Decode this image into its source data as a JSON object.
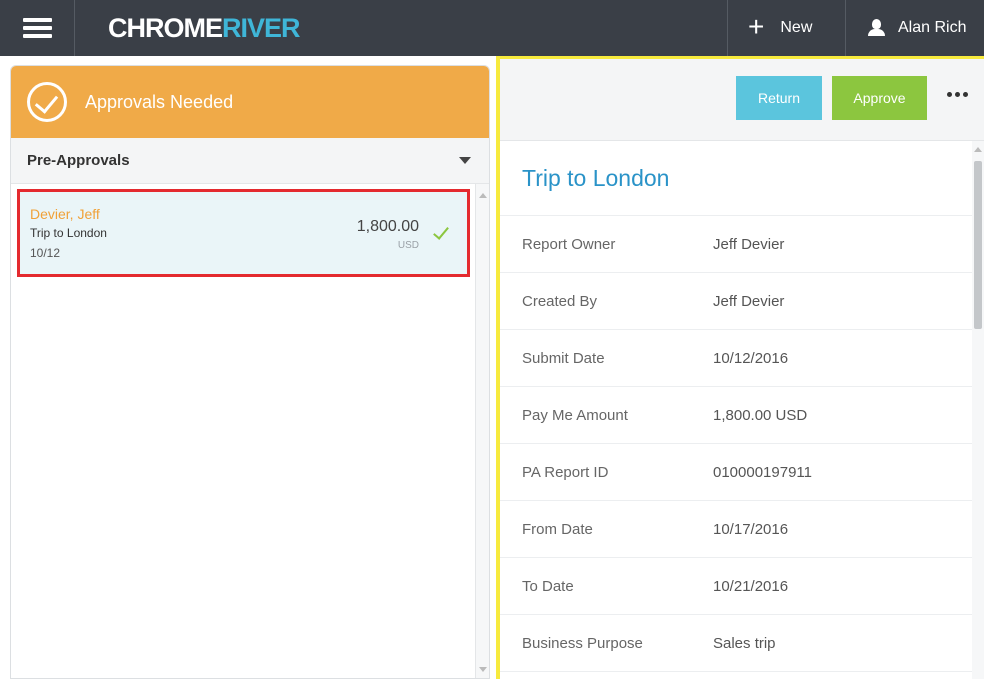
{
  "header": {
    "logo_part1": "CHROME",
    "logo_part2": "RIVER",
    "new_label": "New",
    "new_icon": "plus-icon",
    "user_name": "Alan Rich",
    "user_icon": "user-icon"
  },
  "left_panel": {
    "title": "Approvals Needed",
    "title_icon": "check-circle-icon",
    "section_label": "Pre-Approvals",
    "items": [
      {
        "name": "Devier, Jeff",
        "description": "Trip to London",
        "date": "10/12",
        "amount": "1,800.00",
        "currency": "USD",
        "status_icon": "check-icon"
      }
    ]
  },
  "right_panel": {
    "return_label": "Return",
    "approve_label": "Approve",
    "more_icon": "more-horizontal-icon",
    "title": "Trip to London",
    "fields": [
      {
        "label": "Report Owner",
        "value": "Jeff Devier"
      },
      {
        "label": "Created By",
        "value": "Jeff Devier"
      },
      {
        "label": "Submit Date",
        "value": "10/12/2016"
      },
      {
        "label": "Pay Me Amount",
        "value": "1,800.00 USD"
      },
      {
        "label": "PA Report ID",
        "value": "010000197911"
      },
      {
        "label": "From Date",
        "value": "10/17/2016"
      },
      {
        "label": "To Date",
        "value": "10/21/2016"
      },
      {
        "label": "Business Purpose",
        "value": "Sales trip"
      }
    ]
  },
  "colors": {
    "topbar": "#3a3f47",
    "approvals_header": "#f0aa48",
    "return_button": "#5bc5dd",
    "approve_button": "#8cc63f",
    "title_blue": "#2a93c8",
    "selection_border": "#e42a2f",
    "focus_border": "#f7ea3d"
  }
}
